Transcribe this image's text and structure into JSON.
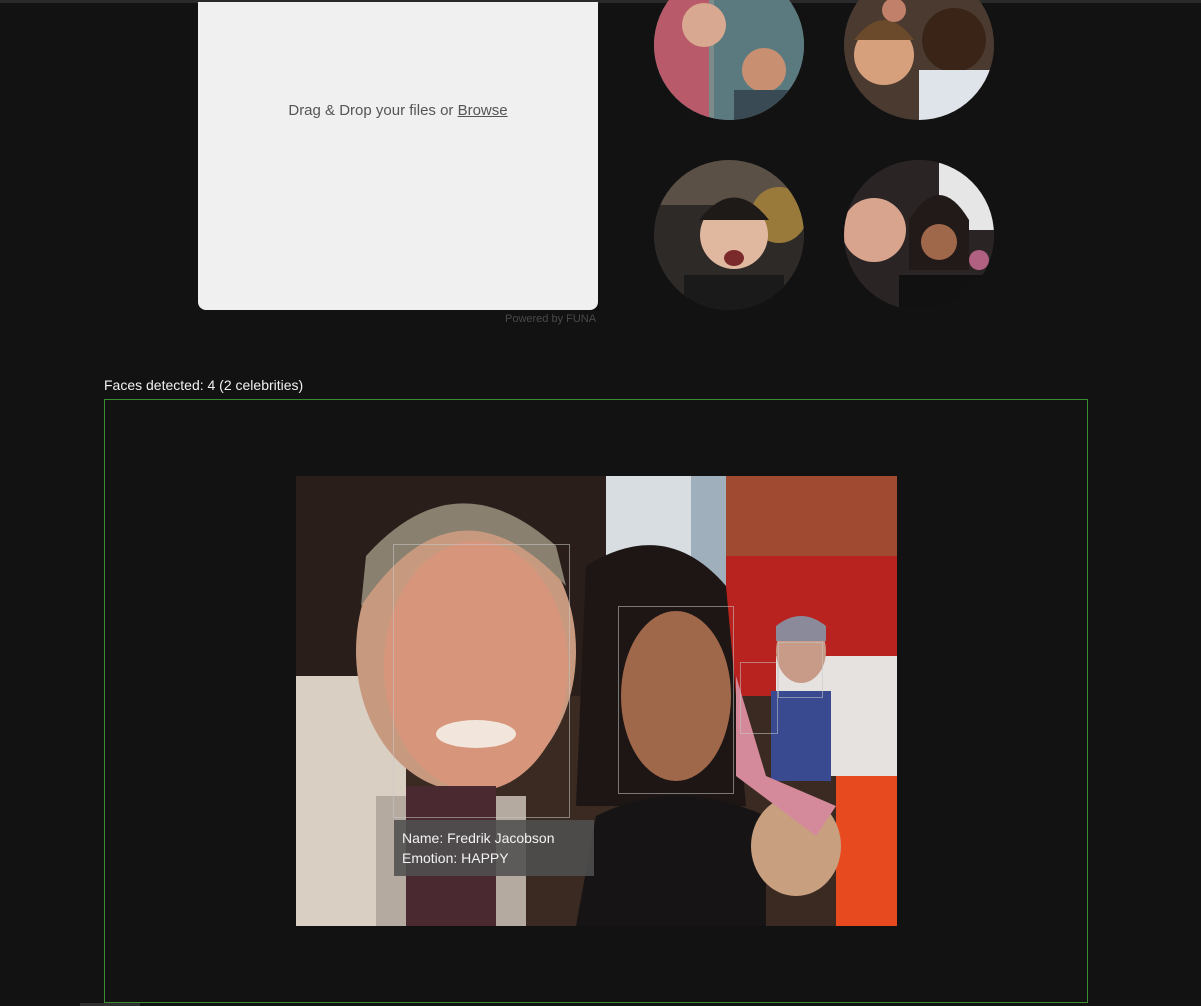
{
  "upload": {
    "prompt_prefix": "Drag & Drop your files or ",
    "browse_label": "Browse",
    "powered_by": "Powered by FUNA"
  },
  "samples": {
    "items": [
      "sample-image-1",
      "sample-image-2",
      "sample-image-3",
      "sample-image-4"
    ]
  },
  "results": {
    "faces_detected": "Faces detected: 4 (2 celebrities)"
  },
  "tooltip": {
    "name_line": "Name: Fredrik Jacobson",
    "emotion_line": "Emotion: HAPPY"
  },
  "colors": {
    "background": "#121212",
    "frame_border": "#3d8a34",
    "dropzone": "#f0f0f0"
  }
}
